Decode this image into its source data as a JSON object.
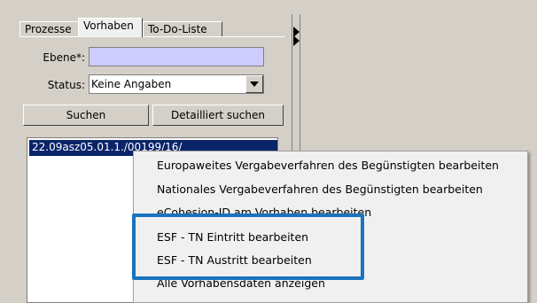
{
  "tabs": [
    {
      "label": "Prozesse"
    },
    {
      "label": "Vorhaben",
      "active": true
    },
    {
      "label": "To-Do-Liste"
    }
  ],
  "form": {
    "ebene_label": "Ebene*:",
    "ebene_value": "",
    "status_label": "Status:",
    "status_value": "Keine Angaben"
  },
  "buttons": {
    "search": "Suchen",
    "detailed_search": "Detailliert suchen"
  },
  "results": {
    "selected_item": "22.09asz05.01.1./00199/16/"
  },
  "context_menu": {
    "items": [
      {
        "label": "Europaweites Vergabeverfahren des Begünstigten bearbeiten"
      },
      {
        "label": "Nationales Vergabeverfahren des Begünstigten bearbeiten"
      },
      {
        "label": "eCohesion-ID am Vorhaben bearbeiten"
      },
      {
        "label": "ESF - TN Eintritt bearbeiten"
      },
      {
        "label": "ESF - TN Austritt bearbeiten"
      },
      {
        "label": "Alle Vorhabensdaten anzeigen"
      }
    ],
    "highlight_color": "#1a73c0"
  }
}
